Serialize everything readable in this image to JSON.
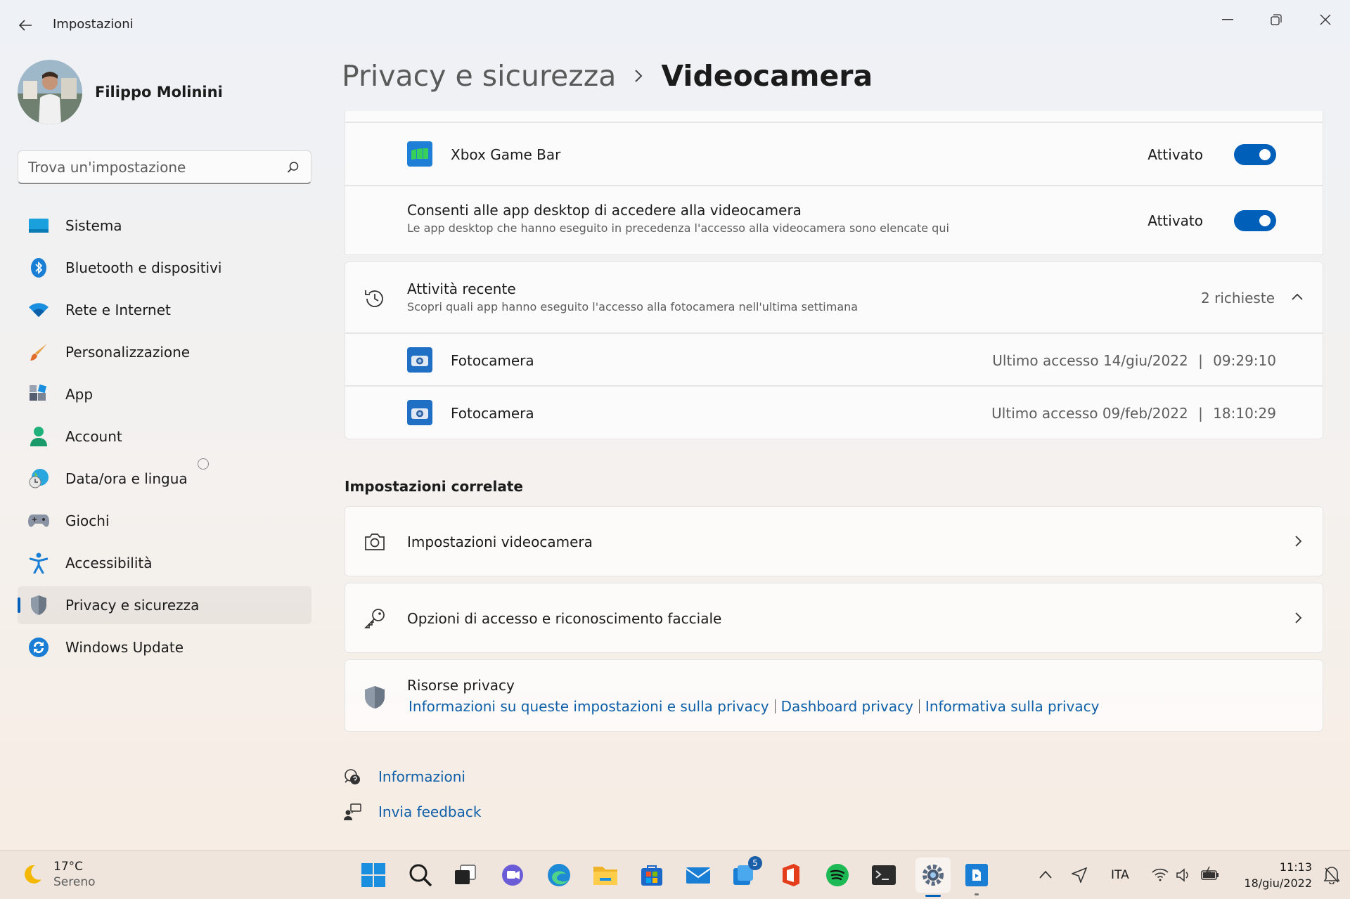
{
  "window": {
    "title": "Impostazioni",
    "back_icon": "back-arrow-icon",
    "minimize_icon": "minimize-icon",
    "restore_icon": "restore-icon",
    "close_icon": "close-icon"
  },
  "profile": {
    "name": "Filippo Molinini"
  },
  "search": {
    "placeholder": "Trova un'impostazione"
  },
  "nav": {
    "items": [
      {
        "label": "Sistema",
        "icon": "monitor-icon"
      },
      {
        "label": "Bluetooth e dispositivi",
        "icon": "bluetooth-icon"
      },
      {
        "label": "Rete e Internet",
        "icon": "wifi-icon"
      },
      {
        "label": "Personalizzazione",
        "icon": "brush-icon"
      },
      {
        "label": "App",
        "icon": "apps-icon"
      },
      {
        "label": "Account",
        "icon": "account-icon"
      },
      {
        "label": "Data/ora e lingua",
        "icon": "globe-clock-icon"
      },
      {
        "label": "Giochi",
        "icon": "gamepad-icon"
      },
      {
        "label": "Accessibilità",
        "icon": "accessibility-icon"
      },
      {
        "label": "Privacy e sicurezza",
        "icon": "shield-icon",
        "active": true
      },
      {
        "label": "Windows Update",
        "icon": "update-icon"
      }
    ]
  },
  "breadcrumb": {
    "parent": "Privacy e sicurezza",
    "current": "Videocamera"
  },
  "app_rows": [
    {
      "name": "Xbox Game Bar",
      "state": "Attivato",
      "on": true
    }
  ],
  "desktop_apps": {
    "title": "Consenti alle app desktop di accedere alla videocamera",
    "subtitle": "Le app desktop che hanno eseguito in precedenza l'accesso alla videocamera sono elencate qui",
    "state": "Attivato"
  },
  "recent_activity": {
    "title": "Attività recente",
    "subtitle": "Scopri quali app hanno eseguito l'accesso alla fotocamera nell'ultima settimana",
    "count": "2 richieste",
    "entries": [
      {
        "app": "Fotocamera",
        "last_access": "Ultimo accesso 14/giu/2022",
        "time": "09:29:10"
      },
      {
        "app": "Fotocamera",
        "last_access": "Ultimo accesso 09/feb/2022",
        "time": "18:10:29"
      }
    ]
  },
  "related": {
    "title": "Impostazioni correlate",
    "camera_settings": "Impostazioni videocamera",
    "signin_options": "Opzioni di accesso e riconoscimento facciale",
    "privacy_resources": {
      "title": "Risorse privacy",
      "links": [
        "Informazioni su queste impostazioni e sulla privacy",
        "Dashboard privacy",
        "Informativa sulla privacy"
      ]
    }
  },
  "footer": {
    "help": "Informazioni",
    "feedback": "Invia feedback"
  },
  "taskbar": {
    "weather": {
      "temp": "17°C",
      "condition": "Sereno"
    },
    "store_badge": "5",
    "language": "ITA",
    "time": "11:13",
    "date": "18/giu/2022"
  },
  "colors": {
    "accent": "#005fb8",
    "link": "#0f5fa8"
  }
}
